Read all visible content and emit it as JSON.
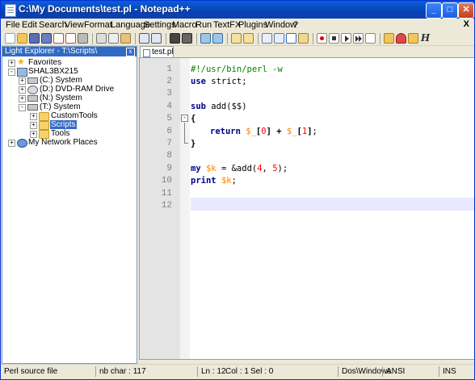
{
  "window": {
    "title": "C:\\My Documents\\test.pl - Notepad++",
    "min_glyph": "_",
    "max_glyph": "□",
    "close_glyph": "✕"
  },
  "menu": [
    "File",
    "Edit",
    "Search",
    "View",
    "Format",
    "Language",
    "Settings",
    "Macro",
    "Run",
    "TextFX",
    "Plugins",
    "Window",
    "?"
  ],
  "menu_close": "X",
  "explorer": {
    "title": "Light Explorer - T:\\Scripts\\",
    "close_glyph": "x",
    "tree": [
      {
        "label": "Favorites",
        "icon": "star-icon",
        "expander": "+"
      },
      {
        "label": "SHAL3BX215",
        "icon": "computer-icon",
        "expander": "-"
      },
      {
        "label": "(C:) System",
        "icon": "drive-icon",
        "expander": "+"
      },
      {
        "label": "(D:) DVD-RAM Drive",
        "icon": "dvd-icon",
        "expander": "+"
      },
      {
        "label": "(N:) System",
        "icon": "network-drive-icon",
        "expander": "+"
      },
      {
        "label": "(T:) System",
        "icon": "network-drive-icon",
        "expander": "-"
      },
      {
        "label": "CustomTools",
        "icon": "folder-icon",
        "expander": "+"
      },
      {
        "label": "Scripts",
        "icon": "folder-icon",
        "expander": "+",
        "selected": true
      },
      {
        "label": "Tools",
        "icon": "folder-icon",
        "expander": "+"
      },
      {
        "label": "My Network Places",
        "icon": "network-icon",
        "expander": "+"
      }
    ]
  },
  "tab": {
    "label": "test.pl"
  },
  "editor": {
    "line_numbers": [
      "1",
      "2",
      "3",
      "4",
      "5",
      "6",
      "7",
      "8",
      "9",
      "10",
      "11",
      "12"
    ],
    "lines": {
      "l1": "#!/usr/bin/perl -w",
      "l2_kw": "use",
      "l2_rest": " strict;",
      "l4_kw": "sub",
      "l4_rest": " add($$)",
      "l5": "{",
      "l6_kw": "return",
      "l6_v1": "$_",
      "l6_b1": "[",
      "l6_n1": "0",
      "l6_b2": "]",
      "l6_plus": " + ",
      "l6_v2": "$_",
      "l6_b3": "[",
      "l6_n2": "1",
      "l6_b4": "]",
      "l6_end": ";",
      "l7": "}",
      "l9_kw": "my",
      "l9_var": "$k",
      "l9_eq": " = &add(",
      "l9_n1": "4",
      "l9_comma": ", ",
      "l9_n2": "5",
      "l9_end": ");",
      "l10_kw": "print",
      "l10_var": "$k",
      "l10_end": ";"
    },
    "fold_glyph": "-"
  },
  "status": {
    "filetype": "Perl source file",
    "nbchar": "nb char : 117",
    "ln": "Ln : 12",
    "col": "Col : 1",
    "sel": "Sel : 0",
    "eol": "Dos\\Windows",
    "encoding": "ANSI",
    "mode": "INS"
  },
  "colors": {
    "titlebar": "#0842b6",
    "selection": "#316ac5",
    "keyword": "#00008b",
    "variable": "#ff8000",
    "number": "#ff0000",
    "comment": "#008000",
    "current_line": "#e8e8ff"
  }
}
